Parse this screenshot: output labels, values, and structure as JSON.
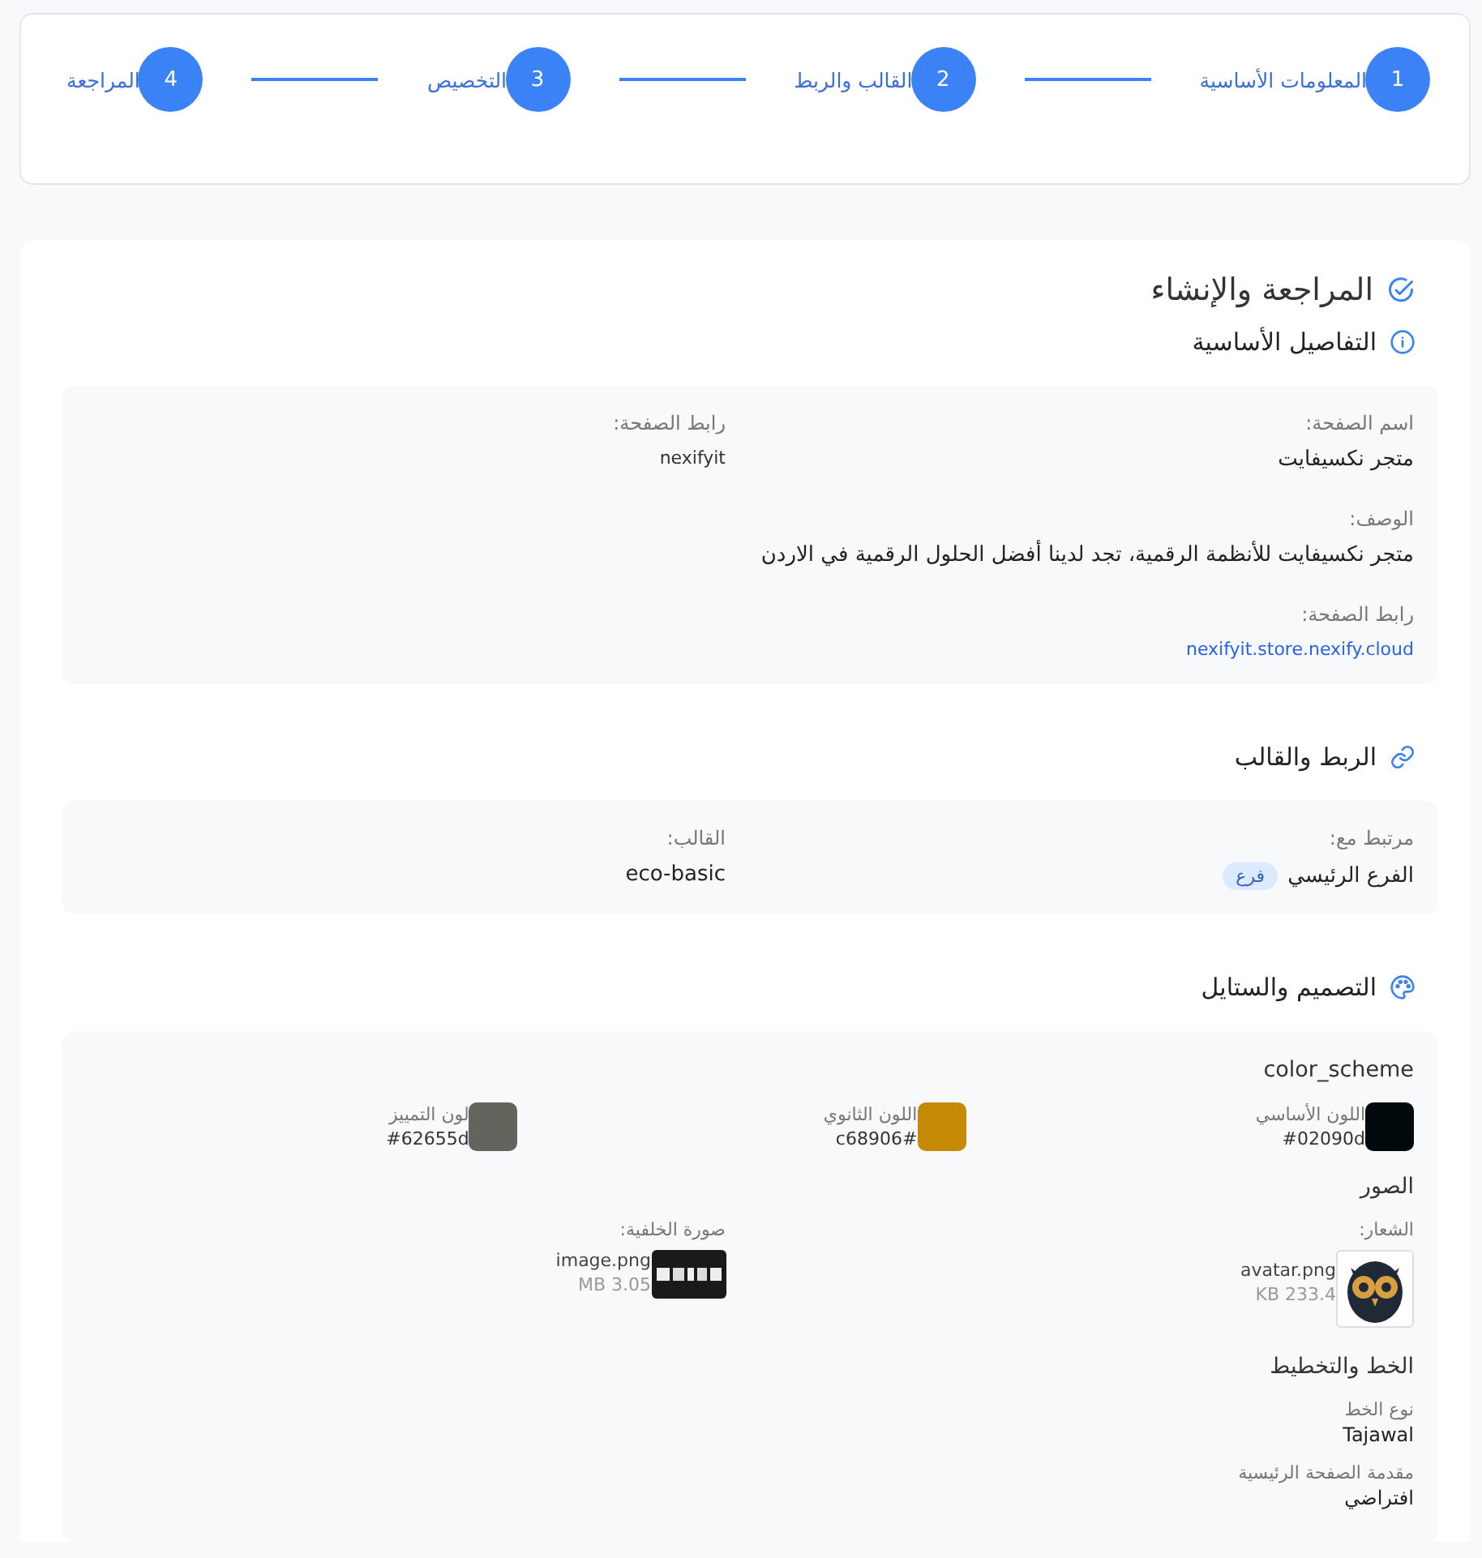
{
  "steps": [
    {
      "number": "1",
      "label": "المعلومات الأساسية"
    },
    {
      "number": "2",
      "label": "القالب والربط"
    },
    {
      "number": "3",
      "label": "التخصيص"
    },
    {
      "number": "4",
      "label": "المراجعة"
    }
  ],
  "title": "المراجعة والإنشاء",
  "basic": {
    "heading": "التفاصيل الأساسية",
    "fields": [
      {
        "label": "اسم الصفحة:",
        "value": "متجر نكسيفايت",
        "kind": "text"
      },
      {
        "label": "رابط الصفحة:",
        "value": "nexifyit",
        "kind": "small"
      },
      {
        "label": "الوصف:",
        "value": "متجر نكسيفايت للأنظمة الرقمية، تجد لدينا أفضل الحلول الرقمية في الاردن",
        "kind": "wide"
      },
      {
        "label": "رابط الصفحة:",
        "value": "nexifyit.store.nexify.cloud",
        "kind": "link"
      }
    ]
  },
  "linking": {
    "heading": "الربط والقالب",
    "fields": [
      {
        "label": "مرتبط مع:",
        "value": "الفرع الرئيسي",
        "badge": "فرع"
      },
      {
        "label": "القالب:",
        "value": "eco-basic"
      }
    ]
  },
  "design": {
    "heading": "التصميم والستايل",
    "color_heading": "color_scheme",
    "colors": [
      {
        "label": "اللون الأساسي",
        "value": "#02090d",
        "color": "#02090d"
      },
      {
        "label": "اللون الثانوي",
        "value": "#c68906",
        "color": "#c68906"
      },
      {
        "label": "لون التمييز",
        "value": "#62655d",
        "color": "#62655d"
      }
    ],
    "images_heading": "الصور",
    "images": [
      {
        "label": "الشعار:",
        "file": "avatar.png",
        "size": "233.4 KB",
        "kind": "picture"
      },
      {
        "label": "صورة الخلفية:",
        "file": "image.png",
        "size": "3.05 MB",
        "kind": "picture"
      }
    ],
    "font_heading": "الخط والتخطيط",
    "font_fields": [
      {
        "label": "نوع الخط",
        "value": "Tajawal"
      },
      {
        "label": "مقدمة الصفحة الرئيسية",
        "value": "افتراضي"
      }
    ]
  }
}
